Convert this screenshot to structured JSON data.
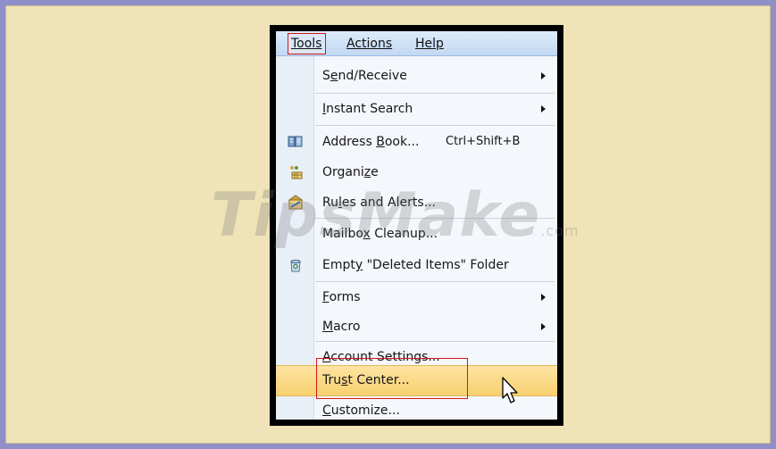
{
  "menubar": {
    "tools": "Tools",
    "actions": "Actions",
    "help": "Help"
  },
  "menu": [
    {
      "label": "Send/Receive",
      "underline": "e",
      "submenu": true,
      "icon": ""
    },
    {
      "label": "Instant Search",
      "underline": "I",
      "submenu": true,
      "icon": ""
    },
    {
      "label": "Address Book...",
      "underline": "B",
      "shortcut": "Ctrl+Shift+B",
      "icon": "address-book-icon"
    },
    {
      "label": "Organize",
      "underline": "z",
      "icon": "organize-icon"
    },
    {
      "label": "Rules and Alerts...",
      "underline": "l",
      "icon": "rules-alerts-icon"
    },
    {
      "label": "Mailbox Cleanup...",
      "underline": "x",
      "icon": ""
    },
    {
      "label": "Empty \"Deleted Items\" Folder",
      "underline": "y",
      "icon": "recycle-bin-icon"
    },
    {
      "label": "Forms",
      "underline": "F",
      "submenu": true,
      "icon": ""
    },
    {
      "label": "Macro",
      "underline": "M",
      "submenu": true,
      "icon": ""
    },
    {
      "label": "Account Settings...",
      "underline": "A",
      "icon": ""
    },
    {
      "label": "Trust Center...",
      "underline": "s",
      "icon": "",
      "highlighted": true
    },
    {
      "label": "Customize...",
      "underline": "C",
      "icon": ""
    }
  ],
  "watermark": {
    "text": "TipsMake",
    "suffix": ".com"
  },
  "colors": {
    "highlight": "#f8d070",
    "redbox": "#d01818",
    "background": "#efe3b7",
    "border": "#8f8fc9"
  }
}
